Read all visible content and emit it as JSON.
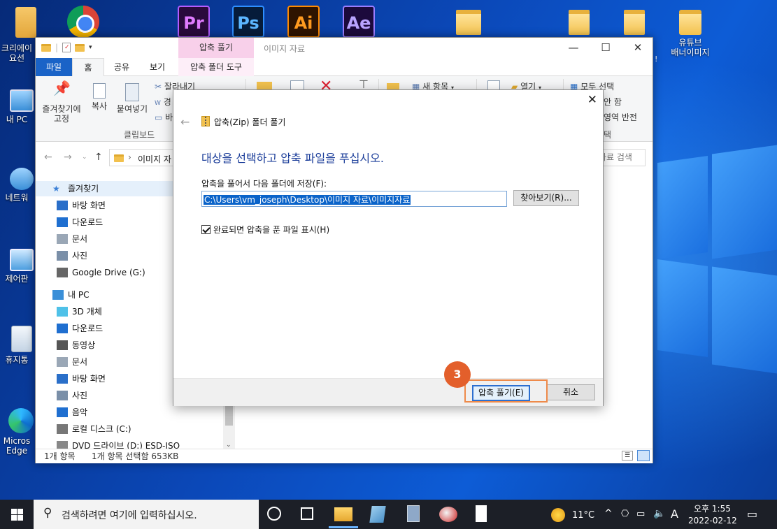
{
  "desktop": {
    "icons": [
      {
        "label": "크리에이\n요선",
        "icon": "user-folder-icon"
      },
      {
        "label": "내 PC",
        "icon": "computer-icon"
      },
      {
        "label": "네트워",
        "icon": "network-icon"
      },
      {
        "label": "제어판",
        "icon": "control-panel-icon"
      },
      {
        "label": "휴지통",
        "icon": "recycle-bin-icon"
      },
      {
        "label": "Micros\nEdge",
        "icon": "edge-icon"
      },
      {
        "label": "유튜브\n배너이미지",
        "icon": "folder-icon"
      }
    ],
    "app_icons": [
      "Pr",
      "Ps",
      "Ai",
      "Ae"
    ],
    "stray_mark": "!"
  },
  "explorer": {
    "title": "이미지 자료",
    "context_tab": "압축 풀기",
    "tabs": [
      "파일",
      "홈",
      "공유",
      "보기",
      "압축 폴더 도구"
    ],
    "ribbon": {
      "pin_label": "즐겨찾기에\n고정",
      "copy_label": "복사",
      "paste_label": "붙여넣기",
      "cut_label": "잘라내기",
      "path_copy_label": "경",
      "shortcut_label": "바",
      "clipboard_group": "클립보드",
      "new_item_label": "새 항목",
      "open_label": "열기",
      "select_all_label": "모두 선택",
      "select_none_label": "안 함",
      "invert_selection_label": "영역 반전",
      "select_group": "택"
    },
    "address": {
      "crumb": "이미지 자",
      "search_placeholder": "자료 검색"
    },
    "nav": [
      {
        "label": "즐겨찾기",
        "icon": "star-icon",
        "indent": 0,
        "selected": true
      },
      {
        "label": "바탕 화면",
        "icon": "desktop-icon",
        "indent": 1
      },
      {
        "label": "다운로드",
        "icon": "download-icon",
        "indent": 1
      },
      {
        "label": "문서",
        "icon": "document-icon",
        "indent": 1
      },
      {
        "label": "사진",
        "icon": "pictures-icon",
        "indent": 1
      },
      {
        "label": "Google Drive (G:)",
        "icon": "drive-icon",
        "indent": 1
      },
      {
        "label": "내 PC",
        "icon": "computer-icon",
        "indent": 0
      },
      {
        "label": "3D 개체",
        "icon": "3d-objects-icon",
        "indent": 1
      },
      {
        "label": "다운로드",
        "icon": "download-icon",
        "indent": 1
      },
      {
        "label": "동영상",
        "icon": "video-icon",
        "indent": 1
      },
      {
        "label": "문서",
        "icon": "document-icon",
        "indent": 1
      },
      {
        "label": "바탕 화면",
        "icon": "desktop-icon",
        "indent": 1
      },
      {
        "label": "사진",
        "icon": "pictures-icon",
        "indent": 1
      },
      {
        "label": "음악",
        "icon": "music-icon",
        "indent": 1
      },
      {
        "label": "로컬 디스크 (C:)",
        "icon": "disk-icon",
        "indent": 1
      },
      {
        "label": "DVD 드라이브 (D:) ESD-ISO",
        "icon": "dvd-icon",
        "indent": 1
      }
    ],
    "status": {
      "count": "1개 항목",
      "selected": "1개 항목 선택함 653KB"
    }
  },
  "dialog": {
    "title": "압축(Zip) 폴더 풀기",
    "heading": "대상을 선택하고 압축 파일을 푸십시오.",
    "folder_label": "압축을 풀어서 다음 폴더에 저장(F):",
    "path_value": "C:\\Users\\vm_joseph\\Desktop\\이미지 자료\\이미지자료",
    "browse_label": "찾아보기(R)...",
    "show_files_label": "완료되면 압축을 푼 파일 표시(H)",
    "show_files_checked": true,
    "extract_label": "압축 풀기(E)",
    "cancel_label": "취소",
    "step_number": "3"
  },
  "taskbar": {
    "search_placeholder": "검색하려면 여기에 입력하십시오.",
    "weather": "11°C",
    "ime": "A",
    "time": "오후 1:55",
    "date": "2022-02-12"
  }
}
